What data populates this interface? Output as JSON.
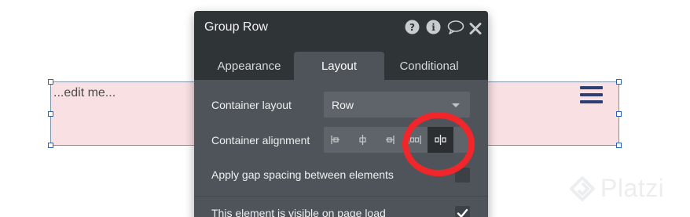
{
  "canvas": {
    "element_text": "...edit me...",
    "menu_icon": "hamburger-menu-icon"
  },
  "watermark": {
    "text": "Platzi"
  },
  "panel": {
    "title": "Group Row",
    "header_icons": [
      "help-icon",
      "info-icon",
      "comment-icon",
      "close-icon"
    ],
    "tabs": [
      {
        "label": "Appearance",
        "active": false
      },
      {
        "label": "Layout",
        "active": true
      },
      {
        "label": "Conditional",
        "active": false
      }
    ],
    "container_layout": {
      "label": "Container layout",
      "value": "Row"
    },
    "container_alignment": {
      "label": "Container alignment",
      "options": [
        "align-left-icon",
        "align-center-icon",
        "align-right-icon",
        "space-around-icon",
        "space-between-icon"
      ],
      "selected": "space-between-icon"
    },
    "gap_spacing": {
      "label": "Apply gap spacing between elements",
      "checked": false
    },
    "visible_on_load": {
      "label": "This element is visible on page load",
      "checked": true
    }
  },
  "annotation": {
    "highlight_color": "#f0262a"
  }
}
